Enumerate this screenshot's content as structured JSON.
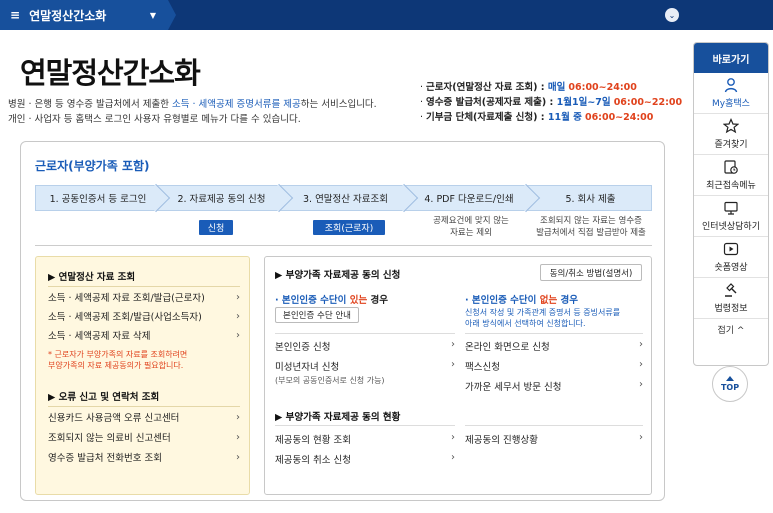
{
  "topbar": {
    "menu_label": "연말정산간소화"
  },
  "header": {
    "title": "연말정산간소화",
    "desc_line1_a": "병원 · 은행 등 영수증 발급처에서 제출한 ",
    "desc_line1_hl": "소득 · 세액공제 증명서류를 제공",
    "desc_line1_b": "하는 서비스입니다.",
    "desc_line2": "개인 · 사업자 등 홈택스 로그인 사용자 유형별로 메뉴가 다를 수 있습니다."
  },
  "schedule": [
    {
      "label": "근로자(연말정산 자료 조회) : ",
      "date": "매일",
      "time": "06:00~24:00"
    },
    {
      "label": "영수증 발급처(공제자료 제출) : ",
      "date": "1월1일~7일",
      "time": "06:00~22:00"
    },
    {
      "label": "기부금 단체(자료제출 신청) : ",
      "date": "11월 중",
      "time": "06:00~24:00"
    }
  ],
  "section": {
    "title": "근로자(부양가족 포함)",
    "steps": [
      "1. 공동인증서 등 로그인",
      "2. 자료제공 동의 신청",
      "3. 연말정산 자료조회",
      "4. PDF 다운로드/인쇄",
      "5. 회사 제출"
    ],
    "pill_apply": "신청",
    "pill_worker": "조회(근로자)",
    "note_step4": "공제요건에 맞지 않는\n자료는 제외",
    "note_step5": "조회되지 않는 자료는 영수증\n발급처에서 직접 발급받아 제출"
  },
  "left_panel": {
    "head1": "▶ 연말정산 자료 조회",
    "items1": [
      "소득 · 세액공제 자료 조회/발급(근로자)",
      "소득 · 세액공제 조회/발급(사업소득자)",
      "소득 · 세액공제 자료 삭제"
    ],
    "note": "* 근로자가 부양가족의 자료를 조회하려면\n  부양가족의 자료 제공동의가 필요합니다.",
    "head2": "▶ 오류 신고 및 연락처 조회",
    "items2": [
      "신용카드 사용금액 오류 신고센터",
      "조회되지 않는 의료비 신고센터",
      "영수증 발급처 전화번호 조회"
    ]
  },
  "right_panel": {
    "head1": "▶ 부양가족 자료제공 동의 신청",
    "method_btn": "동의/취소 방법(설명서)",
    "sub_left_a": "· 본인인증 수단이 ",
    "sub_left_red": "있는",
    "sub_left_b": " 경우",
    "guide_btn": "본인인증 수단 안내",
    "sub_right_a": "· 본인인증 수단이 ",
    "sub_right_red": "없는",
    "sub_right_b": " 경우",
    "sub_right_desc": "신청서 작성 및 가족관계 증명서 등 증빙서류를\n아래 방식에서 선택하여 신청합니다.",
    "left_items": [
      {
        "label": "본인인증 신청",
        "sub": ""
      },
      {
        "label": "미성년자녀 신청",
        "sub": "(부모의 공동인증서로 신청 가능)"
      }
    ],
    "right_items": [
      "온라인 화면으로 신청",
      "팩스신청",
      "가까운 세무서 방문 신청"
    ],
    "head2": "▶ 부양가족 자료제공 동의 현황",
    "status_left": [
      "제공동의 현황 조회",
      "제공동의 취소 신청"
    ],
    "status_right": [
      "제공동의 진행상황"
    ]
  },
  "sidebar": {
    "head": "바로가기",
    "items": [
      {
        "label": "My홈택스",
        "icon": "person-icon"
      },
      {
        "label": "즐겨찾기",
        "icon": "star-icon"
      },
      {
        "label": "최근접속메뉴",
        "icon": "recent-icon"
      },
      {
        "label": "인터넷상담하기",
        "icon": "monitor-icon"
      },
      {
        "label": "숏폼영상",
        "icon": "play-icon"
      },
      {
        "label": "법령정보",
        "icon": "gavel-icon"
      }
    ],
    "fold": "접기 ^",
    "top": "TOP"
  },
  "colors": {
    "navy": "#0d3777",
    "primary": "#17509c",
    "accent_blue": "#1a5cb8",
    "accent_red": "#e0421c",
    "step_bg": "#dbeaf9",
    "panel_yellow": "#fff8e0"
  }
}
